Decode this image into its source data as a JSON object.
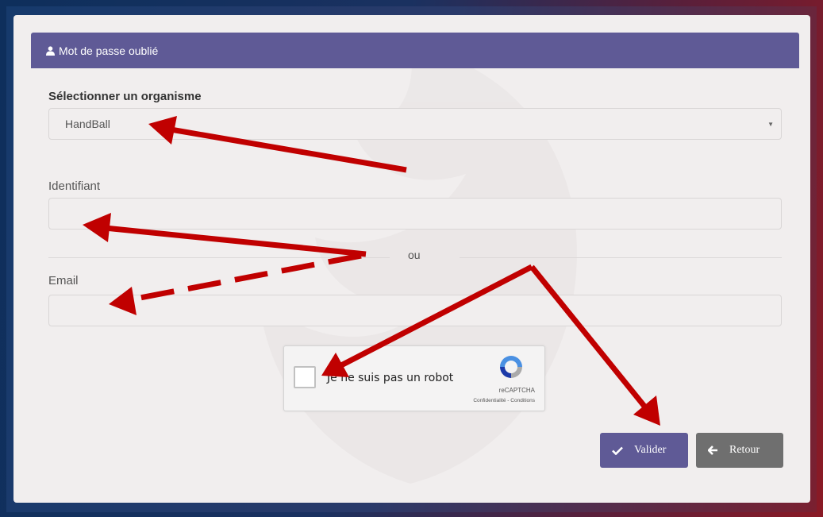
{
  "form": {
    "header_title": "Mot de passe oublié",
    "organism_label": "Sélectionner un organisme",
    "organism_selected": "HandBall",
    "identifier_label": "Identifiant",
    "identifier_value": "",
    "separator_text": "ou",
    "email_label": "Email",
    "email_value": ""
  },
  "recaptcha": {
    "label": "Je ne suis pas un robot",
    "brand": "reCAPTCHA",
    "links": "Confidentialité - Conditions"
  },
  "buttons": {
    "validate_label": "Valider",
    "back_label": "Retour"
  },
  "icons": {
    "header": "user-icon",
    "validate": "check-icon",
    "back": "arrow-left-icon",
    "select": "caret-down-icon"
  },
  "colors": {
    "header_bg": "#5f5a96",
    "validate_bg": "#5f5a96",
    "back_bg": "#6f6f6f",
    "annotation_arrow": "#c00000"
  }
}
